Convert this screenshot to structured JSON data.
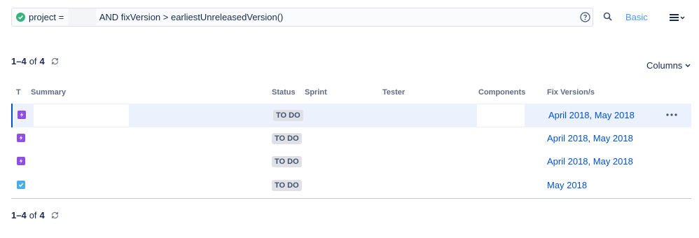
{
  "query": {
    "prefix": "project = ",
    "suffix": " AND fixVersion > earliestUnreleasedVersion()",
    "status_icon": "check-circle-icon",
    "help_icon": "question-circle-icon"
  },
  "toolbar": {
    "search_icon": "search-icon",
    "basic_label": "Basic",
    "menu_icon": "hamburger-menu-icon"
  },
  "pager": {
    "range": "1–4",
    "of": "of",
    "total": "4"
  },
  "columns_button": "Columns",
  "headers": [
    "T",
    "Summary",
    "Status",
    "Sprint",
    "Tester",
    "Components",
    "Fix Version/s"
  ],
  "rows": [
    {
      "type": "story",
      "status": "TO DO",
      "fix_versions": "April 2018, May 2018"
    },
    {
      "type": "story",
      "status": "TO DO",
      "fix_versions": "April 2018, May 2018"
    },
    {
      "type": "story",
      "status": "TO DO",
      "fix_versions": "April 2018, May 2018"
    },
    {
      "type": "task",
      "status": "TO DO",
      "fix_versions": "May 2018"
    }
  ],
  "colors": {
    "link": "#0052cc",
    "basic": "#4c9aff",
    "selected_row": "#ebf2fd",
    "story": "#904ee2",
    "task": "#4bade8",
    "success": "#36b37e"
  }
}
